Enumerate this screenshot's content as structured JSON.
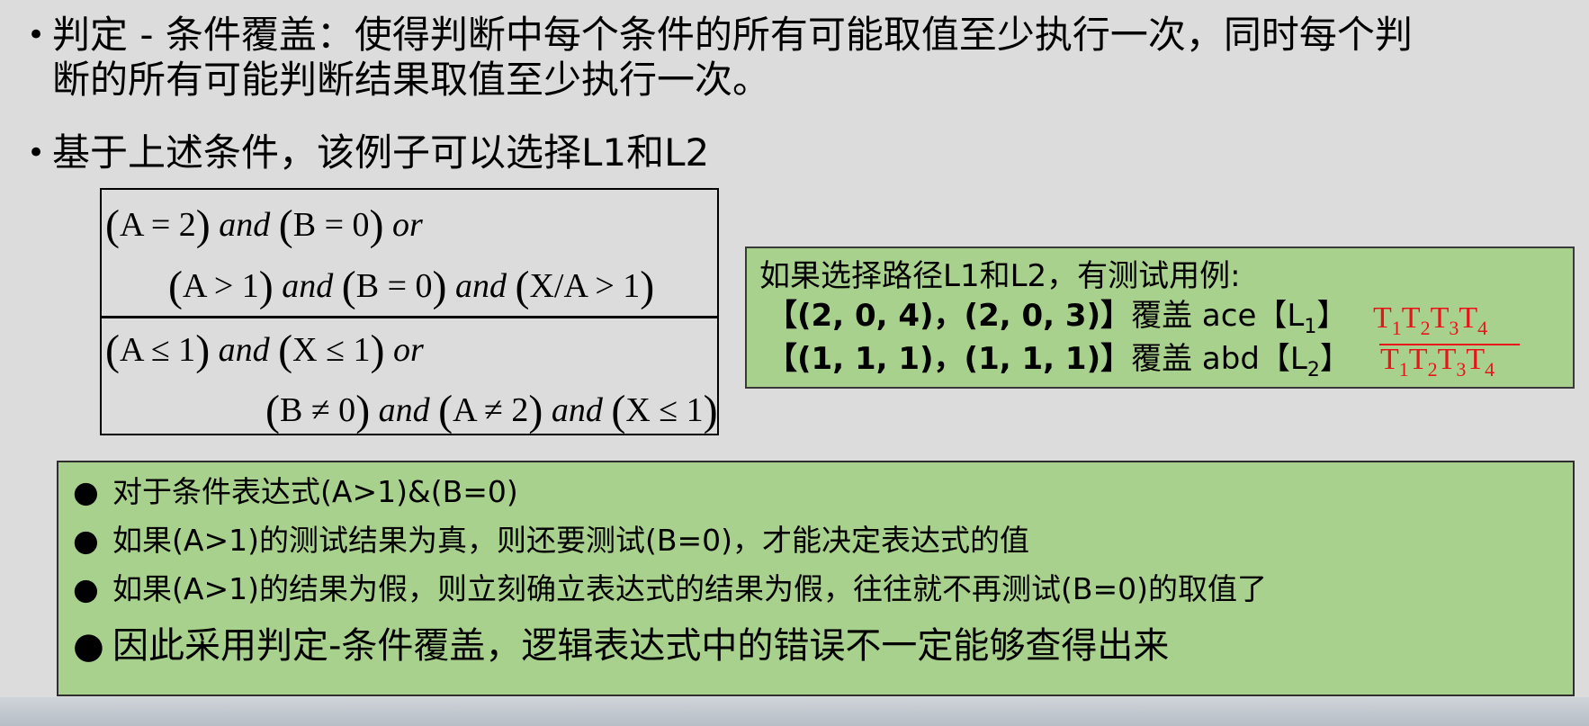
{
  "bullets": [
    {
      "line1": "判定 - 条件覆盖：使得判断中每个条件的所有可能取值至少执行一次，同时每个判",
      "line2": "断的所有可能判断结果取值至少执行一次。"
    },
    {
      "line1": "基于上述条件，该例子可以选择L1和L2"
    }
  ],
  "bullet_symbol": "•",
  "formula": {
    "block1_line1": [
      "(",
      "A = 2",
      ")",
      "and",
      "(",
      "B = 0",
      ")",
      "or"
    ],
    "block1_line2": [
      "(",
      "A > 1",
      ")",
      "and",
      "(",
      "B = 0",
      ")",
      "and",
      "(",
      "X/A > 1",
      ")"
    ],
    "block2_line1": [
      "(",
      "A ≤ 1",
      ")",
      "and",
      "(",
      "X ≤ 1",
      ")",
      "or"
    ],
    "block2_line2": [
      "(",
      "B ≠ 0",
      ")",
      "and",
      "(",
      "A ≠ 2",
      ")",
      "and",
      "(",
      "X ≤ 1",
      ")"
    ]
  },
  "test_cases": {
    "heading": "如果选择路径L1和L2，有测试用例:",
    "rows": [
      {
        "cases": "【(2, 0, 4)，(2, 0, 3)】",
        "cover": "覆盖 ace【L",
        "path_sub": "1",
        "close": "】",
        "t_terms": [
          "T",
          "1",
          "T",
          "2",
          "T",
          "3",
          "T",
          "4"
        ],
        "negated": false
      },
      {
        "cases": "【(1, 1, 1)，(1, 1, 1)】",
        "cover": "覆盖 abd【L",
        "path_sub": "2",
        "close": "】",
        "t_terms": [
          "T",
          "1",
          "T",
          "2",
          "T",
          "3",
          "T",
          "4"
        ],
        "negated": true
      }
    ]
  },
  "notes": [
    "对于条件表达式(A>1)&(B=0)",
    "如果(A>1)的测试结果为真，则还要测试(B=0)，才能决定表达式的值",
    "如果(A>1)的结果为假，则立刻确立表达式的结果为假，往往就不再测试(B=0)的取值了",
    "因此采用判定-条件覆盖，逻辑表达式中的错误不一定能够查得出来"
  ],
  "note_symbol": "●",
  "colors": {
    "background": "#dcdcdc",
    "green_box": "#a9d18e",
    "red_text": "#e8141b"
  }
}
